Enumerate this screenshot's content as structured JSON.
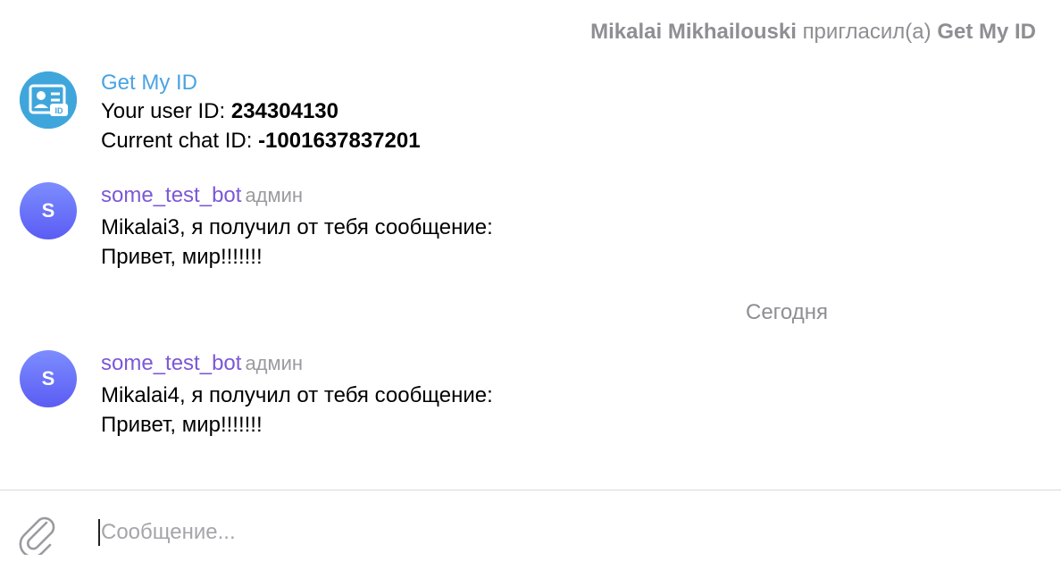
{
  "service_message": {
    "actor": "Mikalai Mikhailouski",
    "action": "пригласил(а)",
    "target": "Get My ID"
  },
  "messages": [
    {
      "sender": "Get My ID",
      "avatar_icon": "id-card-icon",
      "line1_label": "Your user ID: ",
      "line1_value": "234304130",
      "line2_label": "Current chat ID: ",
      "line2_value": "-1001637837201"
    },
    {
      "sender": "some_test_bot",
      "role": "админ",
      "avatar_letter": "S",
      "line1": "Mikalai3, я получил от тебя сообщение:",
      "line2": "Привет, мир!!!!!!!"
    },
    {
      "sender": "some_test_bot",
      "role": "админ",
      "avatar_letter": "S",
      "line1": "Mikalai4, я получил от тебя сообщение:",
      "line2": "Привет, мир!!!!!!!"
    }
  ],
  "date_separator": "Сегодня",
  "composer": {
    "placeholder": "Сообщение...",
    "value": "",
    "attach_icon": "paperclip-icon"
  },
  "colors": {
    "link_blue": "#4aa3e3",
    "bot_purple": "#7b58d6",
    "avatar_gradient_top": "#7c8dff",
    "avatar_gradient_bottom": "#5b5cf3",
    "muted_gray": "#8e8e93"
  }
}
